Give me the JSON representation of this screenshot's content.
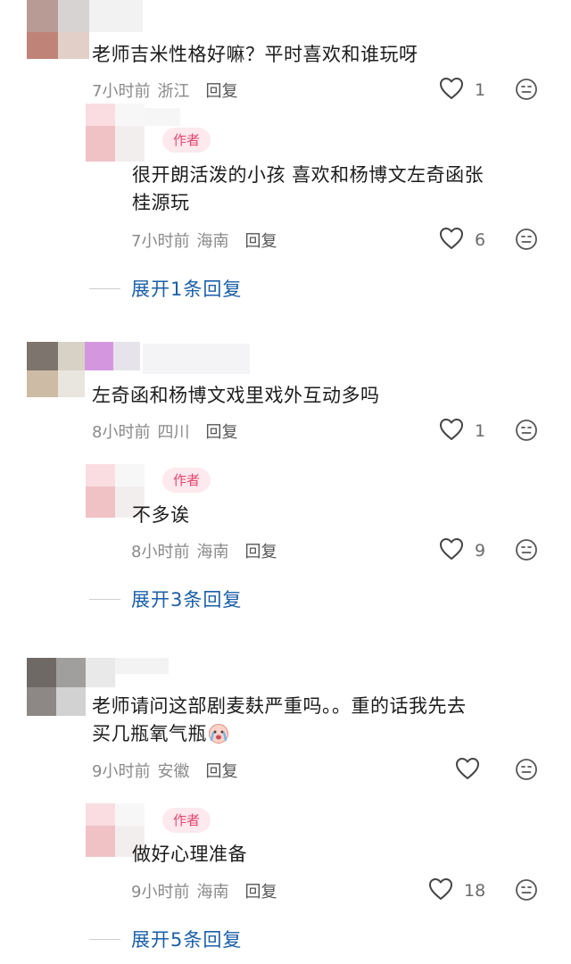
{
  "threads": [
    {
      "comment": {
        "text": "老师吉米性格好嘛？平时喜欢和谁玩呀",
        "time": "7小时前",
        "location": "浙江",
        "reply_label": "回复",
        "likes": "1"
      },
      "reply": {
        "badge": "作者",
        "text": "很开朗活泼的小孩 喜欢和杨博文左奇函张\n桂源玩",
        "time": "7小时前",
        "location": "海南",
        "reply_label": "回复",
        "likes": "6"
      },
      "expand_label": "展开1条回复"
    },
    {
      "comment": {
        "text": "左奇函和杨博文戏里戏外互动多吗",
        "time": "8小时前",
        "location": "四川",
        "reply_label": "回复",
        "likes": "1"
      },
      "reply": {
        "badge": "作者",
        "text": "不多诶",
        "time": "8小时前",
        "location": "海南",
        "reply_label": "回复",
        "likes": "9"
      },
      "expand_label": "展开3条回复"
    },
    {
      "comment": {
        "text": "老师请问这部剧麦麸严重吗。。重的话我先去\n买几瓶氧气瓶",
        "time": "9小时前",
        "location": "安徽",
        "reply_label": "回复",
        "likes": ""
      },
      "reply": {
        "badge": "作者",
        "text": "做好心理准备",
        "time": "9小时前",
        "location": "海南",
        "reply_label": "回复",
        "likes": "18"
      },
      "expand_label": "展开5条回复"
    }
  ],
  "icons": {
    "like": "heart-outline-icon",
    "emoji": "neutral-face-icon",
    "inline_emoji": "crying-face-emoji"
  },
  "colors": {
    "badge_bg": "#fde9ee",
    "badge_text": "#e8456f",
    "expand_link": "#1b5fa8",
    "meta_text": "#8a8a8a"
  }
}
